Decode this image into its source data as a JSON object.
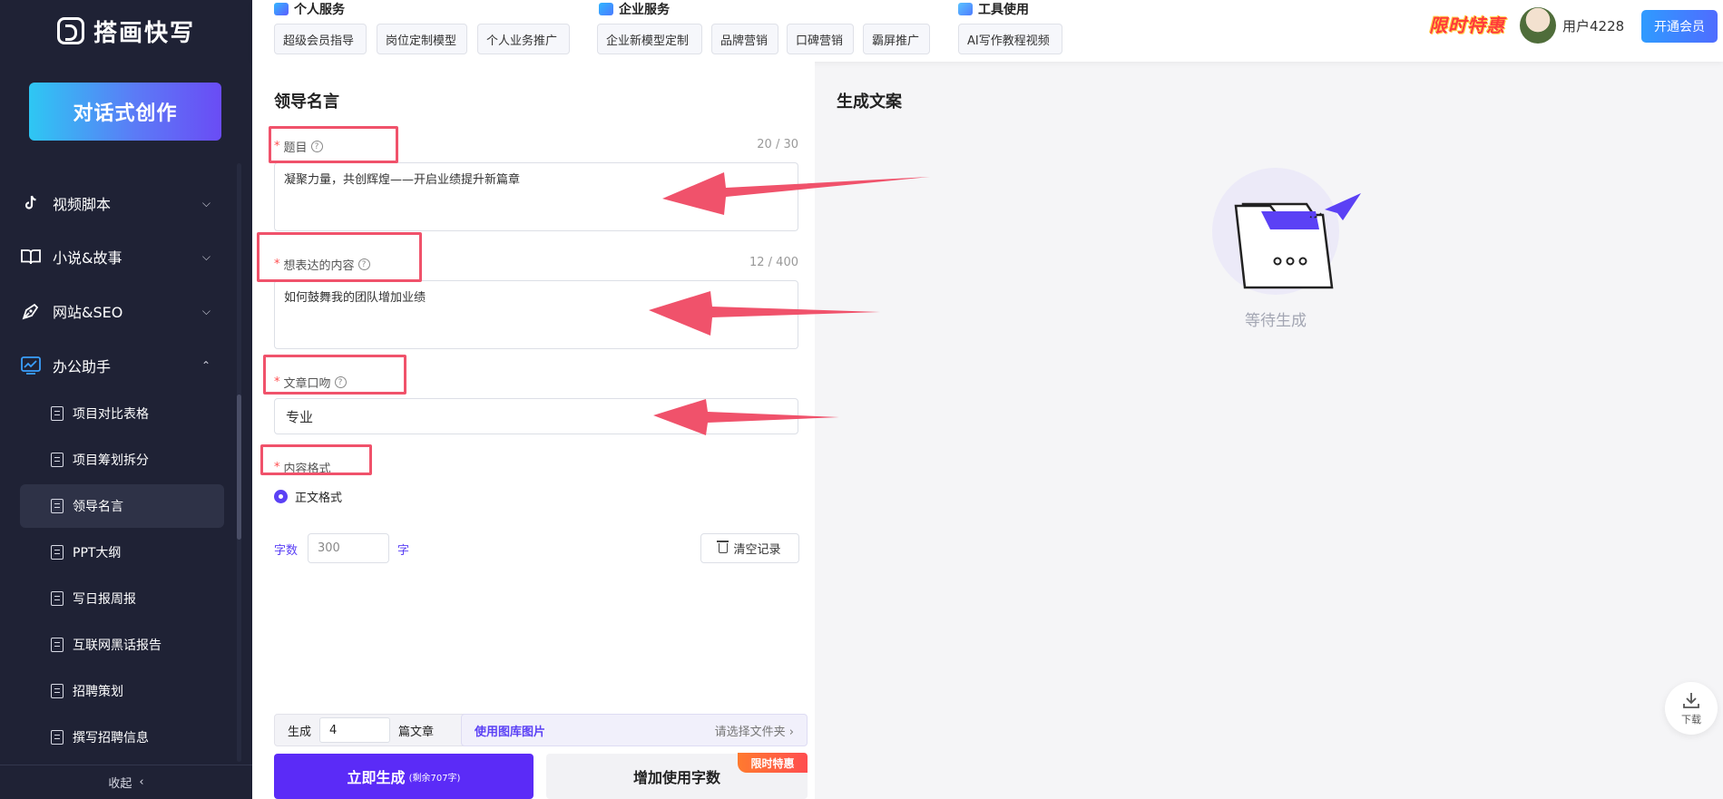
{
  "app": {
    "name": "搭画快写"
  },
  "sidebar": {
    "create_label": "对话式创作",
    "sections": [
      {
        "label": "视频脚本",
        "icon": "tiktok-icon",
        "expanded": false
      },
      {
        "label": "小说&故事",
        "icon": "book-icon",
        "expanded": false
      },
      {
        "label": "网站&SEO",
        "icon": "pen-icon",
        "expanded": false
      },
      {
        "label": "办公助手",
        "icon": "chart-icon",
        "expanded": true
      }
    ],
    "sub_items": [
      {
        "label": "项目对比表格"
      },
      {
        "label": "项目筹划拆分"
      },
      {
        "label": "领导名言",
        "active": true
      },
      {
        "label": "PPT大纲"
      },
      {
        "label": "写日报周报"
      },
      {
        "label": "互联网黑话报告"
      },
      {
        "label": "招聘策划"
      },
      {
        "label": "撰写招聘信息"
      }
    ],
    "collapse_label": "收起"
  },
  "topbar": {
    "groups": [
      {
        "title": "个人服务",
        "tags": [
          "超级会员指导",
          "岗位定制模型",
          "个人业务推广"
        ]
      },
      {
        "title": "企业服务",
        "tags": [
          "企业新模型定制",
          "品牌营销",
          "口碑营销",
          "霸屏推广"
        ]
      },
      {
        "title": "工具使用",
        "tags": [
          "AI写作教程视频"
        ]
      }
    ],
    "promo": "限时特惠",
    "username": "用户4228",
    "vip_button": "开通会员"
  },
  "form": {
    "title": "领导名言",
    "topic": {
      "label": "题目",
      "counter": "20 / 30",
      "value": "凝聚力量，共创辉煌——开启业绩提升新篇章"
    },
    "content": {
      "label": "想表达的内容",
      "counter": "12 / 400",
      "value": "如何鼓舞我的团队增加业绩"
    },
    "tone": {
      "label": "文章口吻",
      "value": "专业"
    },
    "format": {
      "label": "内容格式",
      "option": "正文格式"
    },
    "word_count": {
      "label": "字数",
      "value": "300",
      "unit": "字"
    },
    "clear_label": "清空记录",
    "generate_count": {
      "label": "生成",
      "value": "4",
      "unit": "篇文章"
    },
    "gallery": {
      "label": "使用图库图片",
      "select": "请选择文件夹"
    },
    "generate_button": "立即生成",
    "generate_remaining": "(剩余707字)",
    "add_words_button": "增加使用字数",
    "add_badge": "限时特惠"
  },
  "output": {
    "title": "生成文案",
    "waiting": "等待生成",
    "download_label": "下载"
  },
  "colors": {
    "accent": "#5b41f5",
    "sidebar": "#1f2235",
    "annotation": "#f0526b"
  }
}
